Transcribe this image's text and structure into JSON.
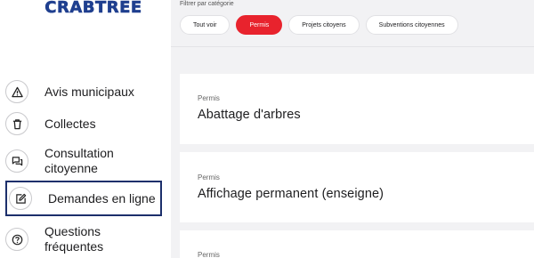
{
  "brand": {
    "logo_text": "CRABTREE"
  },
  "sidebar": {
    "items": [
      {
        "label": "Avis municipaux",
        "icon": "warning-icon"
      },
      {
        "label": "Collectes",
        "icon": "trash-icon"
      },
      {
        "label": "Consultation citoyenne",
        "icon": "chat-icon"
      },
      {
        "label": "Demandes en ligne",
        "icon": "edit-icon",
        "active": true
      },
      {
        "label": "Questions fréquentes",
        "icon": "question-icon"
      }
    ]
  },
  "filters": {
    "label": "Filtrer par catégorie",
    "chips": [
      "Tout voir",
      "Permis",
      "Projets citoyens",
      "Subventions citoyennes"
    ],
    "active": "Permis"
  },
  "cards": [
    {
      "category": "Permis",
      "title": "Abattage d'arbres"
    },
    {
      "category": "Permis",
      "title": "Affichage permanent (enseigne)"
    },
    {
      "category": "Permis",
      "title": ""
    }
  ],
  "colors": {
    "accent_red": "#e8232d",
    "brand_blue": "#1f3f8f",
    "active_border": "#1c2f6b"
  }
}
